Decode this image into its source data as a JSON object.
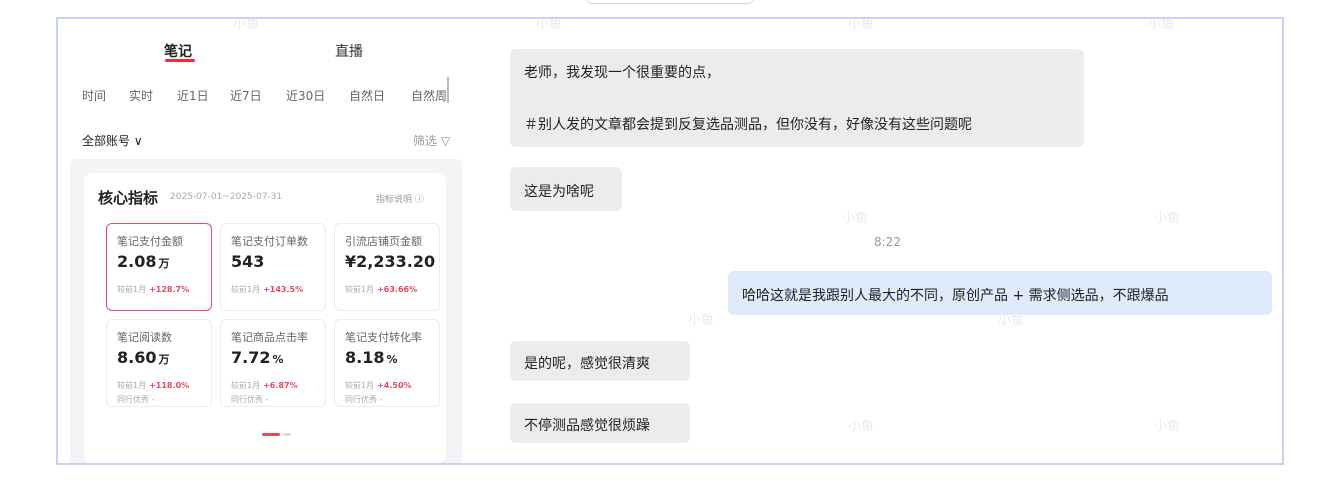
{
  "app": {
    "main_tabs": [
      {
        "label": "笔记",
        "active": true
      },
      {
        "label": "直播",
        "active": false
      }
    ],
    "time_filters": [
      "时间",
      "实时",
      "近1日",
      "近7日",
      "近30日",
      "自然日",
      "自然周"
    ],
    "account_selector": "全部账号 ∨",
    "filter_label": "筛选 ▽"
  },
  "core_metrics": {
    "title": "核心指标",
    "date_range": "2025-07-01~2025-07-31",
    "help_label": "指标说明 ⓘ",
    "items": [
      {
        "label": "笔记支付金额",
        "value": "2.08",
        "unit": "万",
        "compare_label": "较前1月",
        "delta": "+128.7%",
        "peer": ""
      },
      {
        "label": "笔记支付订单数",
        "value": "543",
        "unit": "",
        "compare_label": "较前1月",
        "delta": "+143.5%",
        "peer": ""
      },
      {
        "label": "引流店铺页金额",
        "value": "¥2,233.20",
        "unit": "",
        "compare_label": "较前1月",
        "delta": "+63.66%",
        "peer": ""
      },
      {
        "label": "笔记阅读数",
        "value": "8.60",
        "unit": "万",
        "compare_label": "较前1月",
        "delta": "+118.0%",
        "peer": "同行优秀 -"
      },
      {
        "label": "笔记商品点击率",
        "value": "7.72",
        "unit": "%",
        "compare_label": "较前1月",
        "delta": "+6.87%",
        "peer": "同行优秀 -"
      },
      {
        "label": "笔记支付转化率",
        "value": "8.18",
        "unit": "%",
        "compare_label": "较前1月",
        "delta": "+4.50%",
        "peer": "同行优秀 -"
      }
    ],
    "pagination": {
      "current": 1,
      "total": 2
    }
  },
  "chat": {
    "messages": [
      {
        "side": "left",
        "lines": [
          "老师，我发现一个很重要的点，",
          "",
          "＃别人发的文章都会提到反复选品测品，但你没有，好像没有这些问题呢"
        ]
      },
      {
        "side": "left",
        "lines": [
          "这是为啥呢"
        ]
      },
      {
        "side": "right",
        "lines": [
          "哈哈这就是我跟别人最大的不同，原创产品 + 需求侧选品，不跟爆品"
        ]
      },
      {
        "side": "left",
        "lines": [
          "是的呢，感觉很清爽"
        ]
      },
      {
        "side": "left",
        "lines": [
          "不停测品感觉很烦躁"
        ]
      }
    ],
    "timestamp": "8:22"
  },
  "watermark_text": "小鱼",
  "colors": {
    "accent_red": "#ff2442",
    "frame_border": "#c8d3f0",
    "bubble_left": "#ececec",
    "bubble_right": "#dfeafa"
  }
}
